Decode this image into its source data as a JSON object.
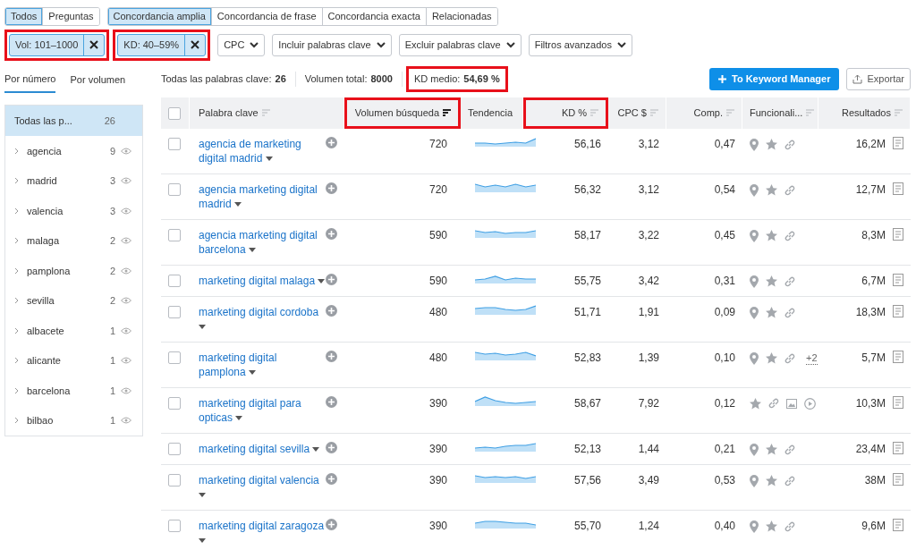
{
  "match_tabs_left": [
    {
      "label": "Todos",
      "selected": true
    },
    {
      "label": "Preguntas",
      "selected": false
    }
  ],
  "match_tabs_right": [
    {
      "label": "Concordancia amplia",
      "selected": true
    },
    {
      "label": "Concordancia de frase",
      "selected": false
    },
    {
      "label": "Concordancia exacta",
      "selected": false
    },
    {
      "label": "Relacionadas",
      "selected": false
    }
  ],
  "active_filters": [
    {
      "label": "Vol: 101–1000",
      "highlighted": true
    },
    {
      "label": "KD: 40–59%",
      "highlighted": true
    }
  ],
  "filter_dropdowns": [
    "CPC",
    "Incluir palabras clave",
    "Excluir palabras clave",
    "Filtros avanzados"
  ],
  "group_tabs": [
    {
      "label": "Por número",
      "selected": true
    },
    {
      "label": "Por volumen",
      "selected": false
    }
  ],
  "stats": [
    {
      "label": "Todas las palabras clave:",
      "value": "26",
      "highlighted": false
    },
    {
      "label": "Volumen total:",
      "value": "8000",
      "highlighted": false
    },
    {
      "label": "KD medio:",
      "value": "54,69 %",
      "highlighted": true
    }
  ],
  "buttons": {
    "primary": "To Keyword Manager",
    "export": "Exportar"
  },
  "groups": [
    {
      "kind": "all",
      "label": "Todas las p...",
      "count": "26",
      "selected": true
    },
    {
      "kind": "group",
      "label": "agencia",
      "count": "9",
      "selected": false
    },
    {
      "kind": "group",
      "label": "madrid",
      "count": "3",
      "selected": false
    },
    {
      "kind": "group",
      "label": "valencia",
      "count": "3",
      "selected": false
    },
    {
      "kind": "group",
      "label": "malaga",
      "count": "2",
      "selected": false
    },
    {
      "kind": "group",
      "label": "pamplona",
      "count": "2",
      "selected": false
    },
    {
      "kind": "group",
      "label": "sevilla",
      "count": "2",
      "selected": false
    },
    {
      "kind": "group",
      "label": "albacete",
      "count": "1",
      "selected": false
    },
    {
      "kind": "group",
      "label": "alicante",
      "count": "1",
      "selected": false
    },
    {
      "kind": "group",
      "label": "barcelona",
      "count": "1",
      "selected": false
    },
    {
      "kind": "group",
      "label": "bilbao",
      "count": "1",
      "selected": false
    }
  ],
  "table": {
    "select_all_checked": false,
    "columns": [
      {
        "kind": "sortable",
        "label": "Palabra clave",
        "sorted": false,
        "highlighted": false
      },
      {
        "kind": "sortable",
        "label": "Volumen búsqueda",
        "sorted": true,
        "highlighted": true
      },
      {
        "kind": "plain",
        "label": "Tendencia",
        "highlighted": false
      },
      {
        "kind": "sortable",
        "label": "KD %",
        "sorted": false,
        "highlighted": true
      },
      {
        "kind": "sortable",
        "label": "CPC $",
        "sorted": false,
        "highlighted": false
      },
      {
        "kind": "sortable",
        "label": "Comp.",
        "sorted": false,
        "highlighted": false
      },
      {
        "kind": "sortable",
        "label": "Funcionali...",
        "sorted": false,
        "highlighted": false
      },
      {
        "kind": "sortable",
        "label": "Resultados",
        "sorted": false,
        "highlighted": false
      }
    ],
    "rows": [
      {
        "checked": false,
        "keyword": "agencia de marketing digital madrid",
        "volume": "720",
        "kd": "56,16",
        "cpc": "3,12",
        "comp": "0,47",
        "features": [
          {
            "kind": "pin"
          },
          {
            "kind": "star"
          },
          {
            "kind": "link"
          }
        ],
        "results": "16,2M"
      },
      {
        "checked": false,
        "keyword": "agencia marketing digital madrid",
        "volume": "720",
        "kd": "56,32",
        "cpc": "3,12",
        "comp": "0,54",
        "features": [
          {
            "kind": "pin"
          },
          {
            "kind": "star"
          },
          {
            "kind": "link"
          }
        ],
        "results": "12,7M"
      },
      {
        "checked": false,
        "keyword": "agencia marketing digital barcelona",
        "volume": "590",
        "kd": "58,17",
        "cpc": "3,22",
        "comp": "0,45",
        "features": [
          {
            "kind": "pin"
          },
          {
            "kind": "star"
          },
          {
            "kind": "link"
          }
        ],
        "results": "8,3M"
      },
      {
        "checked": false,
        "keyword": "marketing digital malaga",
        "volume": "590",
        "kd": "55,75",
        "cpc": "3,42",
        "comp": "0,31",
        "features": [
          {
            "kind": "pin"
          },
          {
            "kind": "star"
          },
          {
            "kind": "link"
          }
        ],
        "results": "6,7M"
      },
      {
        "checked": false,
        "keyword": "marketing digital cordoba",
        "volume": "480",
        "kd": "51,71",
        "cpc": "1,91",
        "comp": "0,09",
        "features": [
          {
            "kind": "pin"
          },
          {
            "kind": "star"
          },
          {
            "kind": "link"
          }
        ],
        "results": "18,3M"
      },
      {
        "checked": false,
        "keyword": "marketing digital pamplona",
        "volume": "480",
        "kd": "52,83",
        "cpc": "1,39",
        "comp": "0,10",
        "features": [
          {
            "kind": "pin"
          },
          {
            "kind": "star"
          },
          {
            "kind": "link"
          }
        ],
        "features_more": "+2",
        "results": "5,7M"
      },
      {
        "checked": false,
        "keyword": "marketing digital para opticas",
        "volume": "390",
        "kd": "58,67",
        "cpc": "7,92",
        "comp": "0,12",
        "features": [
          {
            "kind": "star"
          },
          {
            "kind": "link"
          },
          {
            "kind": "image"
          },
          {
            "kind": "video"
          }
        ],
        "results": "10,3M"
      },
      {
        "checked": false,
        "keyword": "marketing digital sevilla",
        "volume": "390",
        "kd": "52,13",
        "cpc": "1,44",
        "comp": "0,21",
        "features": [
          {
            "kind": "pin"
          },
          {
            "kind": "star"
          },
          {
            "kind": "link"
          }
        ],
        "results": "23,4M"
      },
      {
        "checked": false,
        "keyword": "marketing digital valencia",
        "volume": "390",
        "kd": "57,56",
        "cpc": "3,49",
        "comp": "0,53",
        "features": [
          {
            "kind": "pin"
          },
          {
            "kind": "star"
          },
          {
            "kind": "link"
          }
        ],
        "results": "38M"
      },
      {
        "checked": false,
        "keyword": "marketing digital zaragoza",
        "volume": "390",
        "kd": "55,70",
        "cpc": "1,24",
        "comp": "0,40",
        "features": [
          {
            "kind": "pin"
          },
          {
            "kind": "star"
          },
          {
            "kind": "link"
          }
        ],
        "results": "9,6M"
      }
    ]
  }
}
